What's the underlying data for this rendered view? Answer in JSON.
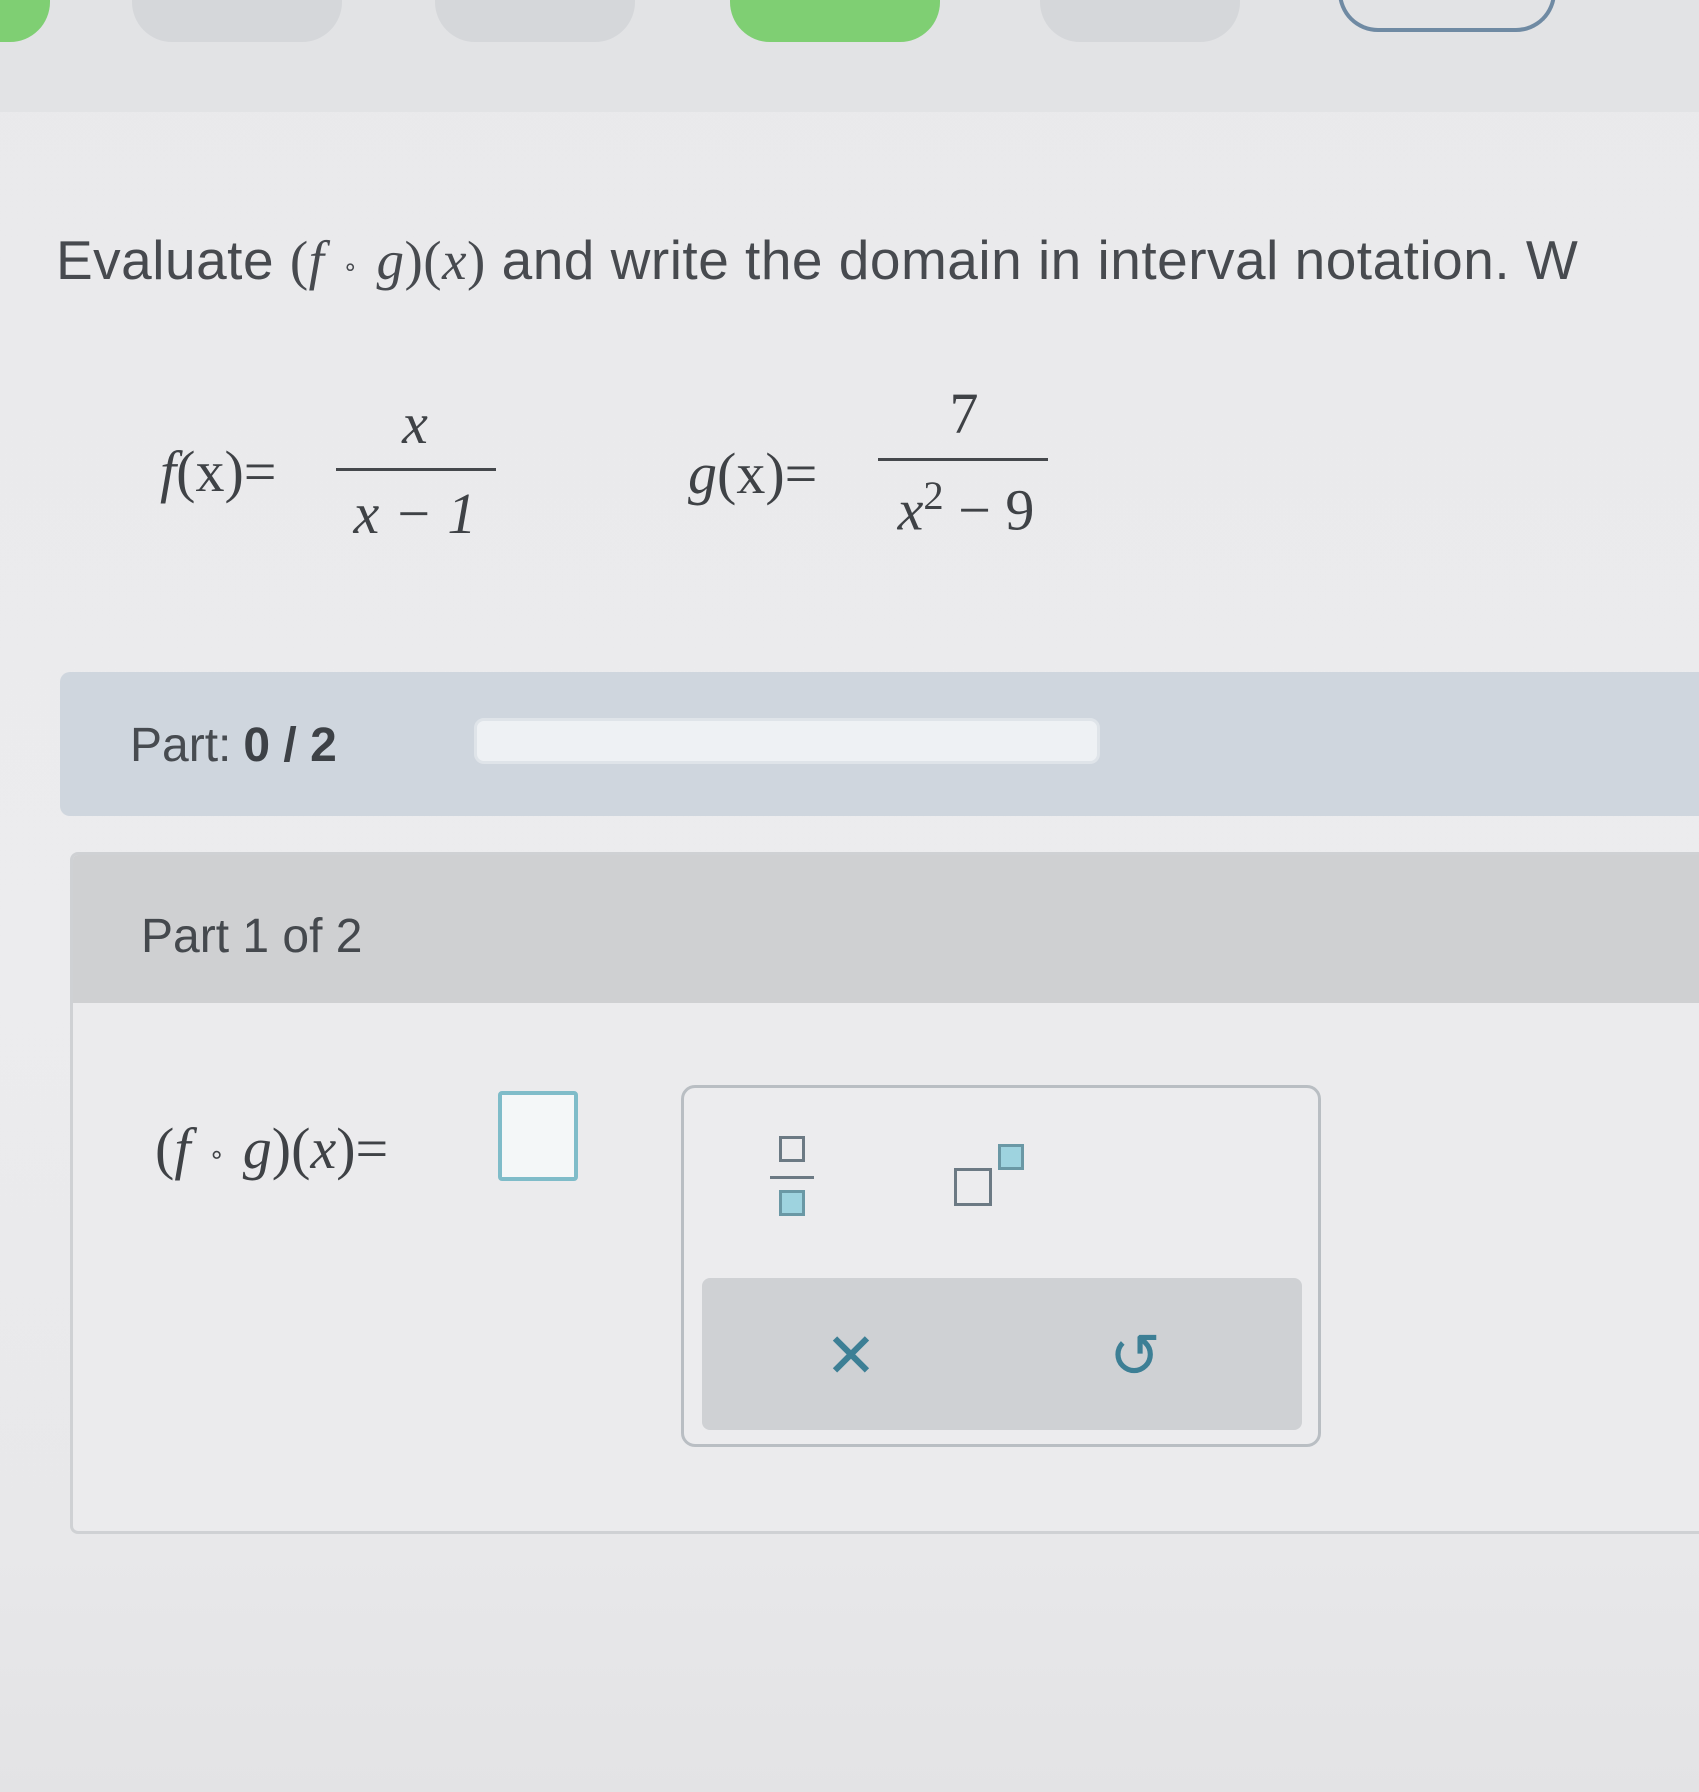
{
  "question": {
    "prefix": "Evaluate",
    "suffix": "and write the domain in interval notation. W"
  },
  "functions": {
    "f": {
      "lhs_name": "f",
      "lhs_arg": "(x)=",
      "numerator": "x",
      "denominator": "x − 1"
    },
    "g": {
      "lhs_name": "g",
      "lhs_arg": "(x)=",
      "numerator": "7",
      "denominator_var": "x",
      "denominator_exp": "2",
      "denominator_rest": " − 9"
    }
  },
  "progress": {
    "label": "Part:",
    "value": "0 / 2",
    "fraction_complete": 0
  },
  "part": {
    "title": "Part 1 of 2",
    "answer_placeholder": ""
  },
  "palette": {
    "fraction_icon": "fraction-icon",
    "exponent_icon": "exponent-icon",
    "clear_symbol": "✕",
    "undo_symbol": "↺"
  },
  "colors": {
    "progress_fill": "#6fbf62",
    "input_border": "#7fbcc9",
    "action_icon": "#3d7f95",
    "active_tab": "#7fcf73"
  }
}
